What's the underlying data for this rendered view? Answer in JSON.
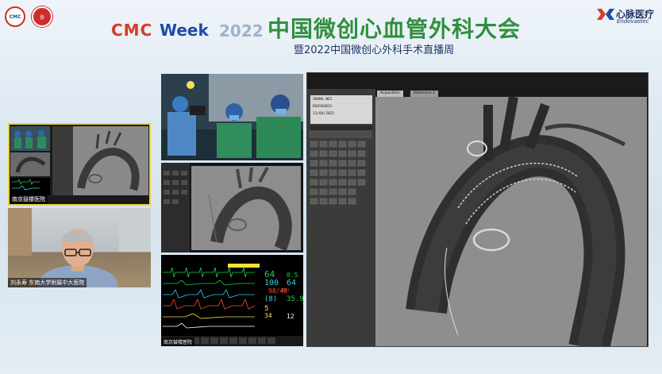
{
  "header": {
    "logo_left_1_text": "CMC",
    "logo_left_2_text": "协",
    "brand_cmc": "CMC",
    "brand_week": "Week",
    "brand_year": "2022",
    "event_title": "中国微创心血管外科大会",
    "event_subtitle": "暨2022中国微创心外科手术直播周",
    "sponsor_cn": "心脉医疗",
    "sponsor_en": "Endovastec"
  },
  "participants": {
    "hospital_caption": "南京鼓楼医院",
    "doctor_caption": "刘永寿 东南大学附属中大医院"
  },
  "angio": {
    "patient_line1": "ZHANG WEI",
    "patient_line2": "DSA503031",
    "patient_line3": "11/04/2022",
    "tab_acquisition": "Acquisition",
    "tab_reference": "Reference 1"
  },
  "vitals": {
    "hr": "64",
    "spo2": "100",
    "pr": "64",
    "abp": "98/48",
    "abp_mean": "(64)",
    "nbp": "(8)",
    "temp": "35.9",
    "val_05": "0.5",
    "cvp": "5",
    "resp": "34",
    "etco2": "12",
    "footer_label": "南京鼓楼医院"
  },
  "colors": {
    "green": "#1fd34a",
    "cyan": "#39d0e6",
    "red": "#ff4a3a",
    "yellow": "#f2e23a",
    "white": "#ffffff"
  }
}
